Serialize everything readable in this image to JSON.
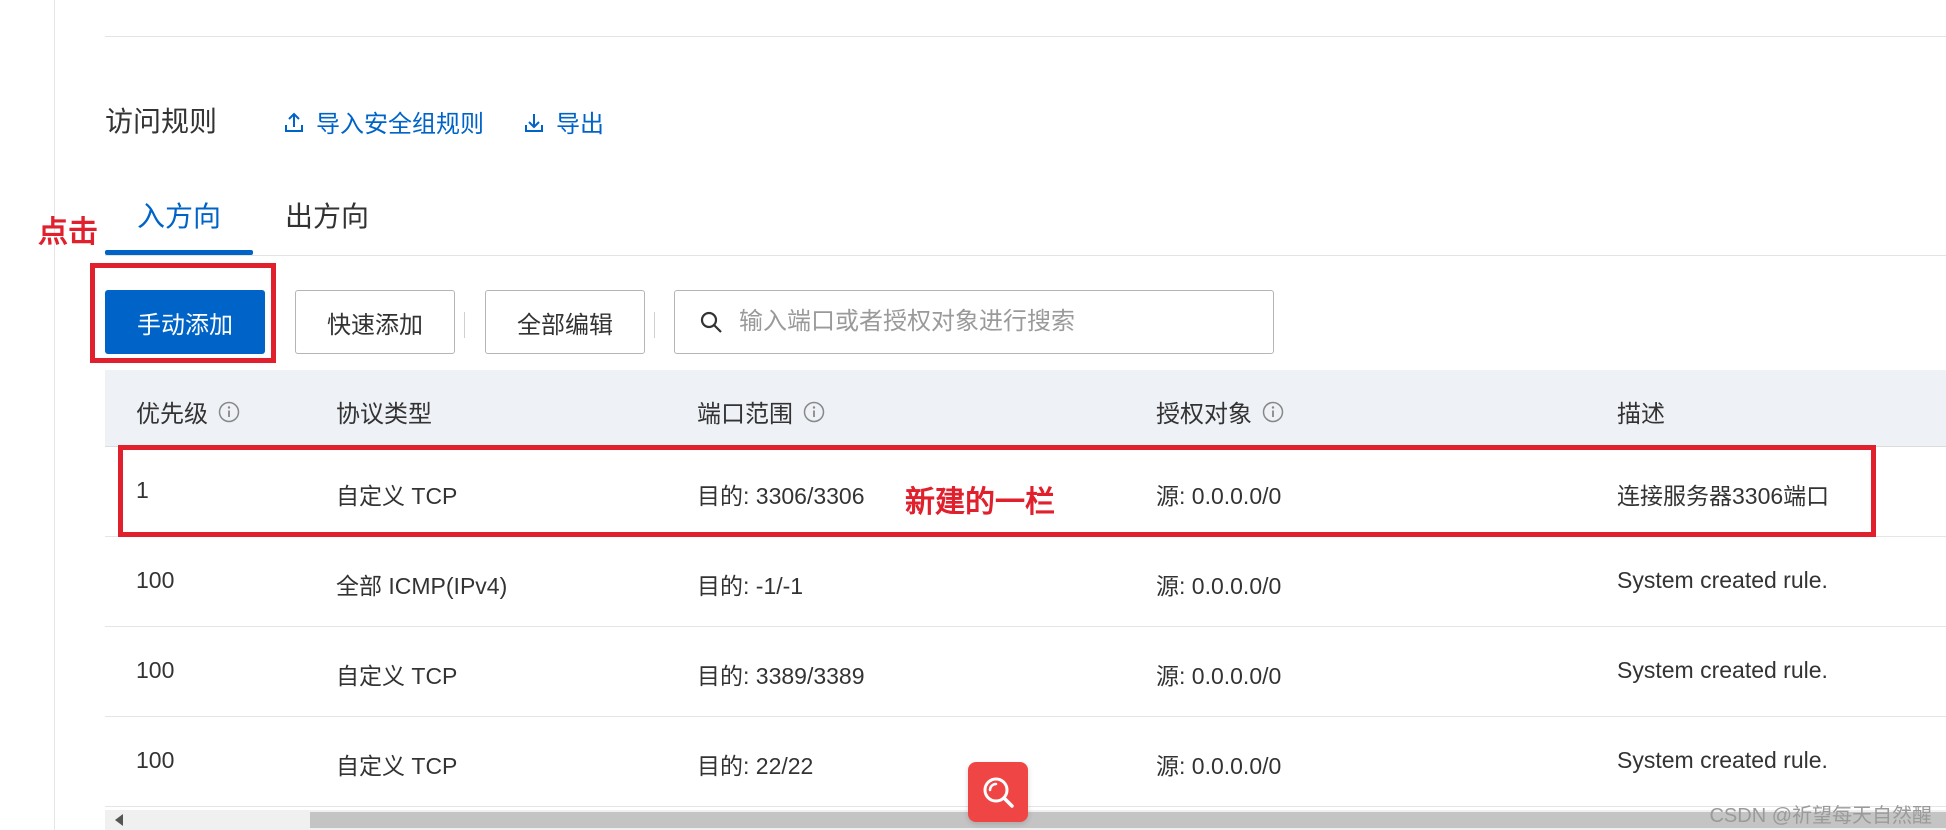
{
  "section": {
    "title": "访问规则",
    "import_label": "导入安全组规则",
    "export_label": "导出"
  },
  "tabs": [
    {
      "label": "入方向",
      "active": true
    },
    {
      "label": "出方向",
      "active": false
    }
  ],
  "toolbar": {
    "manual_add": "手动添加",
    "quick_add": "快速添加",
    "edit_all": "全部编辑"
  },
  "search": {
    "placeholder": "输入端口或者授权对象进行搜索",
    "value": ""
  },
  "table": {
    "columns": [
      "优先级",
      "协议类型",
      "端口范围",
      "授权对象",
      "描述"
    ],
    "rows": [
      {
        "priority": "1",
        "protocol": "自定义 TCP",
        "port": "目的: 3306/3306",
        "source": "源: 0.0.0.0/0",
        "desc": "连接服务器3306端口"
      },
      {
        "priority": "100",
        "protocol": "全部 ICMP(IPv4)",
        "port": "目的: -1/-1",
        "source": "源: 0.0.0.0/0",
        "desc": "System created rule."
      },
      {
        "priority": "100",
        "protocol": "自定义 TCP",
        "port": "目的: 3389/3389",
        "source": "源: 0.0.0.0/0",
        "desc": "System created rule."
      },
      {
        "priority": "100",
        "protocol": "自定义 TCP",
        "port": "目的: 22/22",
        "source": "源: 0.0.0.0/0",
        "desc": "System created rule."
      }
    ]
  },
  "annotations": {
    "click": "点击",
    "new_row": "新建的一栏"
  },
  "watermark": "CSDN @祈望每天自然醒",
  "icons": {
    "import": "upload-icon",
    "export": "download-icon",
    "search": "search-icon",
    "info": "info-circle-icon",
    "fab": "search-fab-icon"
  },
  "colors": {
    "primary": "#0063c8",
    "annotation": "#e0202d",
    "header_bg": "#eef1f5",
    "fab": "#f04545"
  }
}
